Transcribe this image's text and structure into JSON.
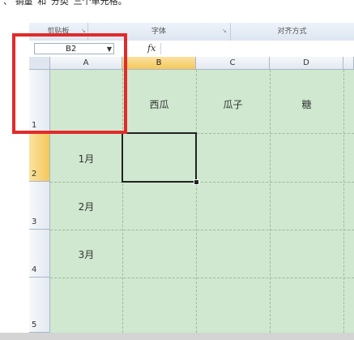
{
  "caption": "、 销量”和“分类”三个单元格。",
  "ribbon": {
    "groups": [
      "剪贴板",
      "字体",
      "对齐方式"
    ]
  },
  "formula_bar": {
    "name_box": "B2",
    "fx_label": "fx",
    "formula": ""
  },
  "sheet": {
    "columns": [
      "A",
      "B",
      "C",
      "D"
    ],
    "rows": [
      "1",
      "2",
      "3",
      "4",
      "5"
    ],
    "active_column": "B",
    "active_row": "2",
    "cells": {
      "B1": "西瓜",
      "C1": "瓜子",
      "D1": "糖",
      "A2": "1月",
      "A3": "2月",
      "A4": "3月"
    }
  },
  "colors": {
    "cell_fill": "#cfe8cf",
    "highlight_box": "#e22a2a",
    "active_header": "#f4c75a"
  }
}
